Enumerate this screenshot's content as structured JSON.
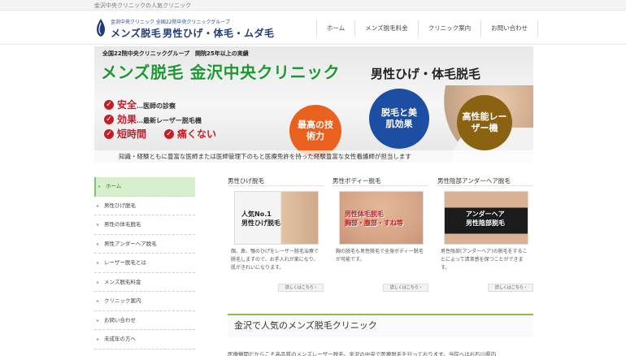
{
  "topbar": {
    "text": "金沢中央クリニックの人気クリニック"
  },
  "logo": {
    "sub": "金沢中央クリニック 全国22院中央クリニックグループ",
    "main": "メンズ脱毛",
    "main2": "男性ひげ・体毛・ムダ毛",
    "icon": "clinic-logo-icon"
  },
  "nav": {
    "items": [
      "ホーム",
      "メンズ脱毛料金",
      "クリニック案内",
      "お問い合わせ"
    ]
  },
  "hero": {
    "top_small": "全国22院中央クリニックグループ　開院25年以上の実績",
    "title": "メンズ脱毛 金沢中央クリニック",
    "subtitle": "男性ひげ・体毛脱毛",
    "features": [
      {
        "key": "安全",
        "desc": "…医師の診察"
      },
      {
        "key": "効果",
        "desc": "…最新レーザー脱毛機"
      },
      {
        "key": "短時間",
        "desc": ""
      },
      {
        "key": "痛くない",
        "desc": ""
      }
    ],
    "circles": [
      "最高の技術力",
      "脱毛と美肌効果",
      "高性能レーザー機"
    ],
    "circle_colors": [
      "#e9601f",
      "#1c4fa3",
      "#8a6212"
    ],
    "band": "知識・経験ともに豊富な医師または医師管理下のもと医療免許を持った経験豊富な女性看護師が担当します"
  },
  "sidebar": {
    "items": [
      "ホーム",
      "男性ひげ脱毛",
      "男性の体毛脱毛",
      "男性アンダーヘア脱毛",
      "レーザー脱毛とは",
      "メンズ脱毛料金",
      "クリニック案内",
      "お問い合わせ",
      "未成年の方へ"
    ]
  },
  "cards": [
    {
      "title": "男性ひげ脱毛",
      "img_text": "人気No.1\n男性ひげ脱毛",
      "desc": "顔、鼻、顎のひげをレーザー脱毛治療で脱毛しますので、お手入れが楽になり、肌がきれいになります。",
      "more": "詳しくはこちら ›"
    },
    {
      "title": "男性ボディー脱毛",
      "img_text": "男性体毛脱毛\n胸部・腹部・すね等",
      "desc": "胸の脱毛も男性脱毛で全身ボディー脱毛が可能です。",
      "more": "詳しくはこちら ›"
    },
    {
      "title": "男性陰部アンダーヘア脱毛",
      "img_text": "アンダーヘア\n男性陰部脱毛",
      "desc": "男性陰部(アンダーヘア)の脱毛をすることによって清潔感を保つことができます。",
      "more": "詳しくはこちら ›"
    }
  ],
  "section": {
    "title": "金沢で人気のメンズ脱毛クリニック"
  },
  "body_text": "医療機関だからこそ高品質のメンズレーザー脱毛。金沢の中央で医療脱毛を行っております。当院へはお石川県内"
}
